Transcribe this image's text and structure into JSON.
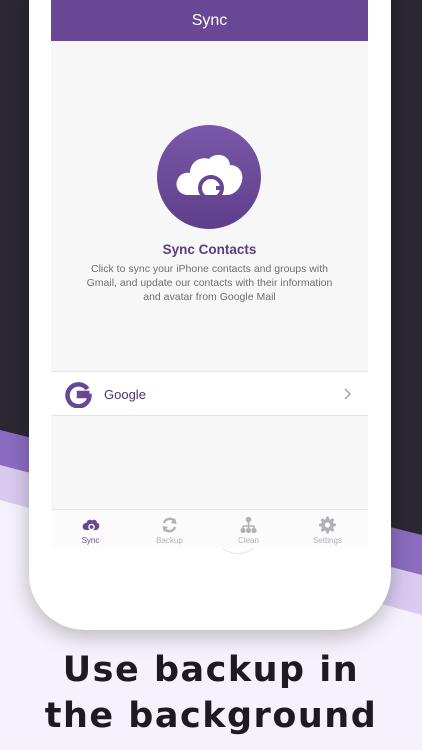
{
  "header": {
    "title": "Sync"
  },
  "hero": {
    "title": "Sync Contacts",
    "description": "Click to sync your iPhone contacts and groups with Gmail, and update our contacts with their information and avatar from Google Mail"
  },
  "accounts": [
    {
      "label": "Google",
      "icon": "google-g-icon"
    }
  ],
  "tabs": [
    {
      "label": "Sync",
      "icon": "cloud-sync-icon",
      "active": true
    },
    {
      "label": "Backup",
      "icon": "refresh-icon",
      "active": false
    },
    {
      "label": "Clean",
      "icon": "hierarchy-icon",
      "active": false
    },
    {
      "label": "Settings",
      "icon": "gear-icon",
      "active": false
    }
  ],
  "caption": {
    "line1": "Use backup in",
    "line2": "the background"
  },
  "colors": {
    "accent": "#6a4795",
    "accent_dark": "#5b3d84",
    "tab_inactive": "#b2b1b6",
    "background_dark": "#2c2833"
  }
}
